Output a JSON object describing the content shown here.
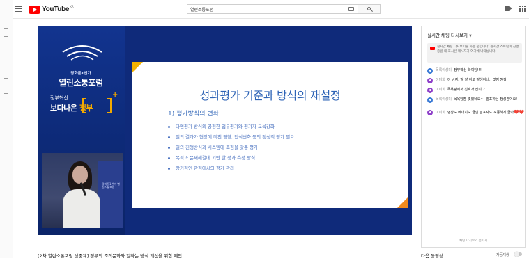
{
  "topbar": {
    "logo_text": "YouTube",
    "logo_region": "KR",
    "search_value": "열린소통포럼"
  },
  "video": {
    "brand_small": "광화문1번가",
    "brand_large": "열린소통포럼",
    "slogan_top": "정부혁신",
    "slogan_bottom_a": "보다나은 ",
    "slogan_bottom_b": "정부",
    "podium_text": "광화문1번가 열린소통포럼",
    "slide": {
      "title": "성과평가 기준과 방식의 재설정",
      "subtitle": "1)   평가방식의 변화",
      "bullets": [
        "다면평가 방식의 공정한 업무평가와 평가자 교육강화",
        "일의 결과가 현장에 미친 영향, 인식변화 등의 정성적 평가 필요",
        "일의 진행방식과 시스템에 초점을 맞춘 평가",
        "목적과 문제해결에 기반 한 성과 측정 방식",
        "장기적인 관점에서의 평가 관리"
      ]
    },
    "title": "[2차 열린소통포럼 생중계] 정부의 조직문화와 일하는 방식 개선을 위한 제안"
  },
  "chat": {
    "header": "실시간 채팅 다시보기",
    "notice": "실시간 채팅 다시보기를 사용 중입니다. 실시간 스트림이 진행 중일 때 표시된 메시지가 여기에 나타납니다.",
    "messages": [
      {
        "author": "목록이성미",
        "text": "정부혁신 화이팅!!!",
        "color": "#3b7bd6"
      },
      {
        "author": "이미희",
        "text": "이 넘자, 말 잘 하고 잘생하네.. 멋짐 짱짱",
        "color": "#8e3fc9"
      },
      {
        "author": "이미희",
        "text": "목욕탕에서 신호가 잡니다.",
        "color": "#8e3fc9"
      },
      {
        "author": "목록이성미",
        "text": "목욕탕뿐 멋있네요~! 발표하는 청성경어요!",
        "color": "#3b7bd6"
      },
      {
        "author": "이미희",
        "text": "영상도 에너지도 금인 발표자도 포퐁하게 금아",
        "color": "#8e3fc9",
        "hearts": "❤️❤️"
      }
    ],
    "footer": "채팅 다시보기 숨기기"
  },
  "sidebar": {
    "next_up": "다음 동영상",
    "autoplay": "자동재생"
  }
}
